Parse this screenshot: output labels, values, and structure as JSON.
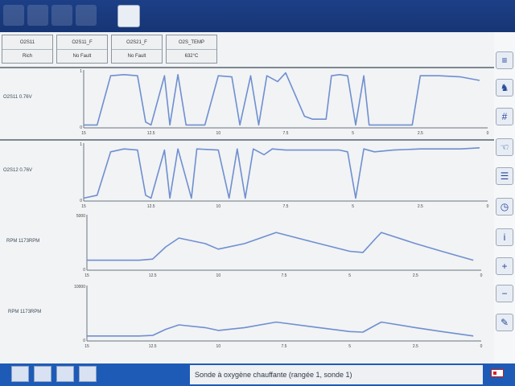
{
  "tiles": [
    {
      "title": "O2S11",
      "value": "Rich"
    },
    {
      "title": "O2S11_F",
      "value": "No Fault"
    },
    {
      "title": "O2S21_F",
      "value": "No Fault"
    },
    {
      "title": "O2S_TEMP",
      "value": "632°C"
    }
  ],
  "chart_data": [
    {
      "type": "line",
      "series": [
        {
          "name": "O2S11 0.76V",
          "values": [
            0.05,
            0.05,
            0.9,
            0.92,
            0.9,
            0.1,
            0.05,
            0.9,
            0.05,
            0.92,
            0.05,
            0.05,
            0.9,
            0.88,
            0.05,
            0.9,
            0.05,
            0.9,
            0.8,
            0.95,
            0.2,
            0.15,
            0.15,
            0.9,
            0.92,
            0.9,
            0.05,
            0.9,
            0.05,
            0.05,
            0.05,
            0.05,
            0.9,
            0.9,
            0.88,
            0.82
          ]
        }
      ],
      "x": [
        15,
        14.5,
        14,
        13.5,
        13,
        12.7,
        12.5,
        12,
        11.8,
        11.5,
        11.2,
        10.5,
        10,
        9.5,
        9.2,
        8.8,
        8.5,
        8.2,
        7.8,
        7.5,
        6.8,
        6.5,
        6,
        5.8,
        5.5,
        5.2,
        4.9,
        4.6,
        4.4,
        4,
        3.5,
        2.8,
        2.5,
        1.8,
        1,
        0.3
      ],
      "xticks": [
        "15",
        "12.5",
        "10",
        "7.5",
        "5",
        "2.5",
        "0"
      ],
      "yticks": [
        "1",
        "0"
      ],
      "ylim": [
        0,
        1
      ]
    },
    {
      "type": "line",
      "series": [
        {
          "name": "O2S12 0.76V",
          "values": [
            0.05,
            0.1,
            0.85,
            0.9,
            0.88,
            0.1,
            0.05,
            0.88,
            0.05,
            0.9,
            0.05,
            0.9,
            0.88,
            0.05,
            0.9,
            0.05,
            0.9,
            0.8,
            0.9,
            0.88,
            0.88,
            0.88,
            0.85,
            0.05,
            0.9,
            0.85,
            0.88,
            0.9,
            0.9,
            0.92
          ]
        }
      ],
      "x": [
        15,
        14.5,
        14,
        13.5,
        13,
        12.7,
        12.5,
        12,
        11.8,
        11.5,
        11,
        10.8,
        10,
        9.6,
        9.3,
        9,
        8.7,
        8.3,
        8,
        7.5,
        6.5,
        5.5,
        5.2,
        4.9,
        4.6,
        4.2,
        3.5,
        2.5,
        1,
        0.3
      ],
      "xticks": [
        "15",
        "12.5",
        "10",
        "7.5",
        "5",
        "2.5",
        "0"
      ],
      "yticks": [
        "1",
        "0"
      ],
      "ylim": [
        0,
        1
      ]
    },
    {
      "type": "line",
      "series": [
        {
          "name": "RPM 1173RPM",
          "values": [
            900,
            900,
            900,
            1000,
            2100,
            2900,
            2400,
            1900,
            2400,
            3400,
            2600,
            1700,
            1600,
            2900,
            3400,
            2400,
            1700,
            900
          ]
        }
      ],
      "x": [
        15,
        14,
        13,
        12.5,
        12,
        11.5,
        10.5,
        10,
        9,
        7.8,
        6.5,
        5,
        4.5,
        4,
        3.8,
        2.5,
        1.5,
        0.3
      ],
      "xticks": [
        "15",
        "12.5",
        "10",
        "7.5",
        "5",
        "2.5",
        "0"
      ],
      "yticks": [
        "5000",
        "0"
      ],
      "ylim": [
        0,
        5000
      ]
    },
    {
      "type": "line",
      "series": [
        {
          "name": "RPM 1173RPM",
          "values": [
            900,
            900,
            900,
            1000,
            2100,
            2900,
            2400,
            1900,
            2400,
            3400,
            2600,
            1700,
            1600,
            2900,
            3400,
            2400,
            1700,
            900
          ]
        }
      ],
      "x": [
        15,
        14,
        13,
        12.5,
        12,
        11.5,
        10.5,
        10,
        9,
        7.8,
        6.5,
        5,
        4.5,
        4,
        3.8,
        2.5,
        1.5,
        0.3
      ],
      "xticks": [
        "15",
        "12.5",
        "10",
        "7.5",
        "5",
        "2.5",
        "0"
      ],
      "yticks": [
        "10000",
        "0"
      ],
      "ylim": [
        0,
        10000
      ]
    }
  ],
  "status": {
    "text": "Sonde à oxygène chauffante (rangée 1, sonde 1)"
  }
}
